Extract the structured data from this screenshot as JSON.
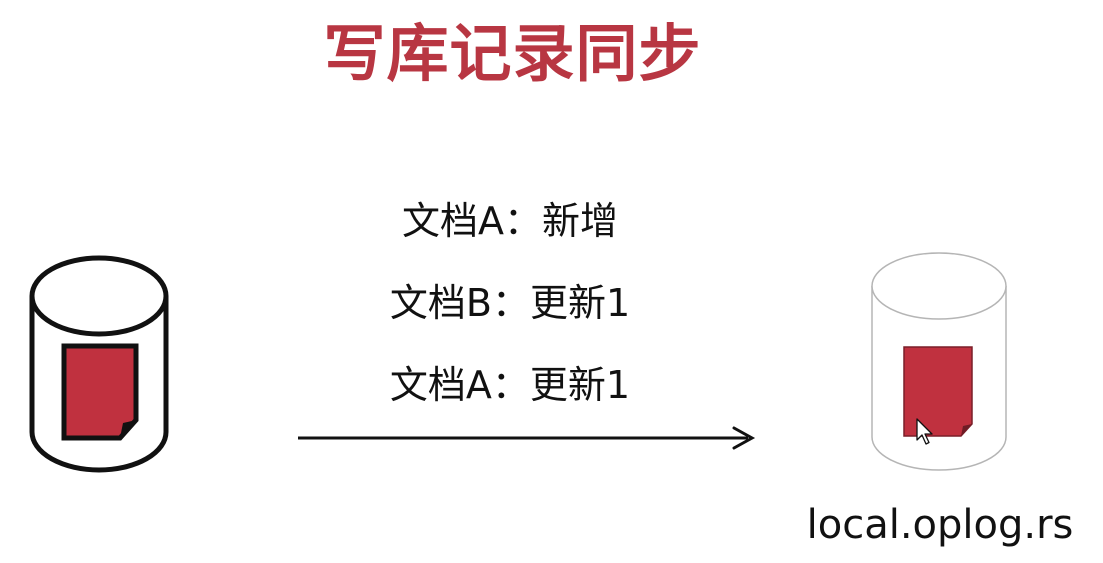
{
  "title": "写库记录同步",
  "operations": [
    "文档A：新增",
    "文档B：更新1",
    "文档A：更新1"
  ],
  "target_label": "local.oplog.rs",
  "colors": {
    "title": "#b83642",
    "document_fill": "#c0313f",
    "document_border_source": "#111111",
    "document_border_target": "#7a1f28",
    "source_outline": "#111111",
    "target_outline": "#b5b5b5",
    "arrow": "#111111"
  },
  "icons": {
    "source": "database-cylinder-icon",
    "target": "database-cylinder-icon",
    "document": "document-icon",
    "pointer": "mouse-pointer-icon"
  }
}
